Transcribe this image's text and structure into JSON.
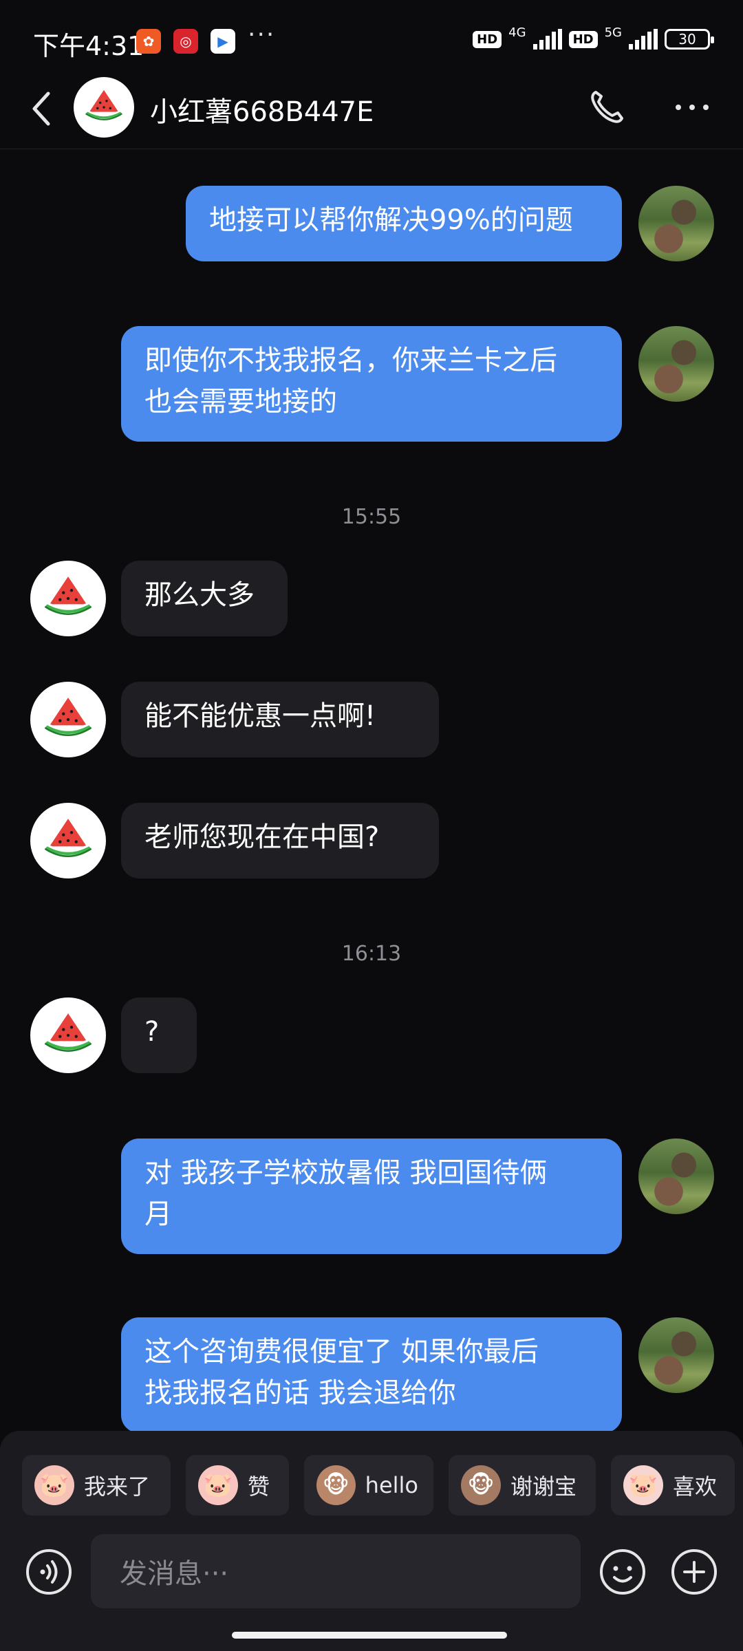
{
  "status_bar": {
    "time": "下午4:31",
    "more": "···",
    "hd1": "HD",
    "net1": "4G",
    "hd2": "HD",
    "net2": "5G",
    "battery": "30"
  },
  "header": {
    "contact_name": "小红薯668B447E"
  },
  "messages": {
    "m1": "地接可以帮你解决99%的问题",
    "m2_line1": "即使你不找我报名，你来兰卡之后",
    "m2_line2": "也会需要地接的",
    "t1": "15:55",
    "m3": "那么大多",
    "m4": "能不能优惠一点啊!",
    "m5": "老师您现在在中国?",
    "t2": "16:13",
    "m6": "?",
    "m7_line1": "对 我孩子学校放暑假  我回国待俩",
    "m7_line2": "月",
    "m8_line1": "这个咨询费很便宜了  如果你最后",
    "m8_line2": "找我报名的话  我会退给你"
  },
  "quick_replies": [
    "我来了",
    "赞",
    "hello",
    "谢谢宝",
    "喜欢"
  ],
  "input": {
    "placeholder": "发消息···"
  },
  "colors": {
    "background": "#0b0b0e",
    "my_bubble": "#4b8bee",
    "their_bubble": "#1e1e23",
    "panel": "#1a1a1f"
  }
}
